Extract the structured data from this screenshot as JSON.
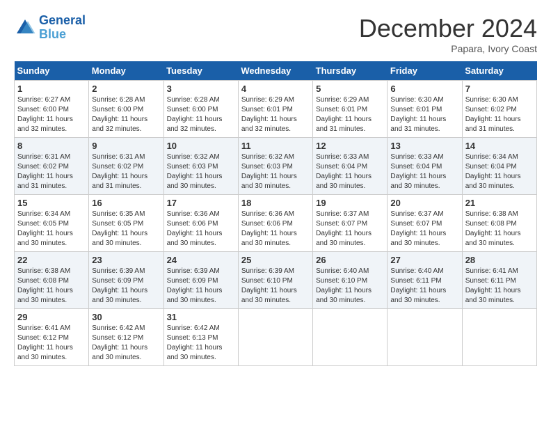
{
  "header": {
    "logo_line1": "General",
    "logo_line2": "Blue",
    "month": "December 2024",
    "location": "Papara, Ivory Coast"
  },
  "weekdays": [
    "Sunday",
    "Monday",
    "Tuesday",
    "Wednesday",
    "Thursday",
    "Friday",
    "Saturday"
  ],
  "weeks": [
    [
      {
        "day": "1",
        "sunrise": "6:27 AM",
        "sunset": "6:00 PM",
        "daylight": "11 hours and 32 minutes."
      },
      {
        "day": "2",
        "sunrise": "6:28 AM",
        "sunset": "6:00 PM",
        "daylight": "11 hours and 32 minutes."
      },
      {
        "day": "3",
        "sunrise": "6:28 AM",
        "sunset": "6:00 PM",
        "daylight": "11 hours and 32 minutes."
      },
      {
        "day": "4",
        "sunrise": "6:29 AM",
        "sunset": "6:01 PM",
        "daylight": "11 hours and 32 minutes."
      },
      {
        "day": "5",
        "sunrise": "6:29 AM",
        "sunset": "6:01 PM",
        "daylight": "11 hours and 31 minutes."
      },
      {
        "day": "6",
        "sunrise": "6:30 AM",
        "sunset": "6:01 PM",
        "daylight": "11 hours and 31 minutes."
      },
      {
        "day": "7",
        "sunrise": "6:30 AM",
        "sunset": "6:02 PM",
        "daylight": "11 hours and 31 minutes."
      }
    ],
    [
      {
        "day": "8",
        "sunrise": "6:31 AM",
        "sunset": "6:02 PM",
        "daylight": "11 hours and 31 minutes."
      },
      {
        "day": "9",
        "sunrise": "6:31 AM",
        "sunset": "6:02 PM",
        "daylight": "11 hours and 31 minutes."
      },
      {
        "day": "10",
        "sunrise": "6:32 AM",
        "sunset": "6:03 PM",
        "daylight": "11 hours and 30 minutes."
      },
      {
        "day": "11",
        "sunrise": "6:32 AM",
        "sunset": "6:03 PM",
        "daylight": "11 hours and 30 minutes."
      },
      {
        "day": "12",
        "sunrise": "6:33 AM",
        "sunset": "6:04 PM",
        "daylight": "11 hours and 30 minutes."
      },
      {
        "day": "13",
        "sunrise": "6:33 AM",
        "sunset": "6:04 PM",
        "daylight": "11 hours and 30 minutes."
      },
      {
        "day": "14",
        "sunrise": "6:34 AM",
        "sunset": "6:04 PM",
        "daylight": "11 hours and 30 minutes."
      }
    ],
    [
      {
        "day": "15",
        "sunrise": "6:34 AM",
        "sunset": "6:05 PM",
        "daylight": "11 hours and 30 minutes."
      },
      {
        "day": "16",
        "sunrise": "6:35 AM",
        "sunset": "6:05 PM",
        "daylight": "11 hours and 30 minutes."
      },
      {
        "day": "17",
        "sunrise": "6:36 AM",
        "sunset": "6:06 PM",
        "daylight": "11 hours and 30 minutes."
      },
      {
        "day": "18",
        "sunrise": "6:36 AM",
        "sunset": "6:06 PM",
        "daylight": "11 hours and 30 minutes."
      },
      {
        "day": "19",
        "sunrise": "6:37 AM",
        "sunset": "6:07 PM",
        "daylight": "11 hours and 30 minutes."
      },
      {
        "day": "20",
        "sunrise": "6:37 AM",
        "sunset": "6:07 PM",
        "daylight": "11 hours and 30 minutes."
      },
      {
        "day": "21",
        "sunrise": "6:38 AM",
        "sunset": "6:08 PM",
        "daylight": "11 hours and 30 minutes."
      }
    ],
    [
      {
        "day": "22",
        "sunrise": "6:38 AM",
        "sunset": "6:08 PM",
        "daylight": "11 hours and 30 minutes."
      },
      {
        "day": "23",
        "sunrise": "6:39 AM",
        "sunset": "6:09 PM",
        "daylight": "11 hours and 30 minutes."
      },
      {
        "day": "24",
        "sunrise": "6:39 AM",
        "sunset": "6:09 PM",
        "daylight": "11 hours and 30 minutes."
      },
      {
        "day": "25",
        "sunrise": "6:39 AM",
        "sunset": "6:10 PM",
        "daylight": "11 hours and 30 minutes."
      },
      {
        "day": "26",
        "sunrise": "6:40 AM",
        "sunset": "6:10 PM",
        "daylight": "11 hours and 30 minutes."
      },
      {
        "day": "27",
        "sunrise": "6:40 AM",
        "sunset": "6:11 PM",
        "daylight": "11 hours and 30 minutes."
      },
      {
        "day": "28",
        "sunrise": "6:41 AM",
        "sunset": "6:11 PM",
        "daylight": "11 hours and 30 minutes."
      }
    ],
    [
      {
        "day": "29",
        "sunrise": "6:41 AM",
        "sunset": "6:12 PM",
        "daylight": "11 hours and 30 minutes."
      },
      {
        "day": "30",
        "sunrise": "6:42 AM",
        "sunset": "6:12 PM",
        "daylight": "11 hours and 30 minutes."
      },
      {
        "day": "31",
        "sunrise": "6:42 AM",
        "sunset": "6:13 PM",
        "daylight": "11 hours and 30 minutes."
      },
      null,
      null,
      null,
      null
    ]
  ]
}
